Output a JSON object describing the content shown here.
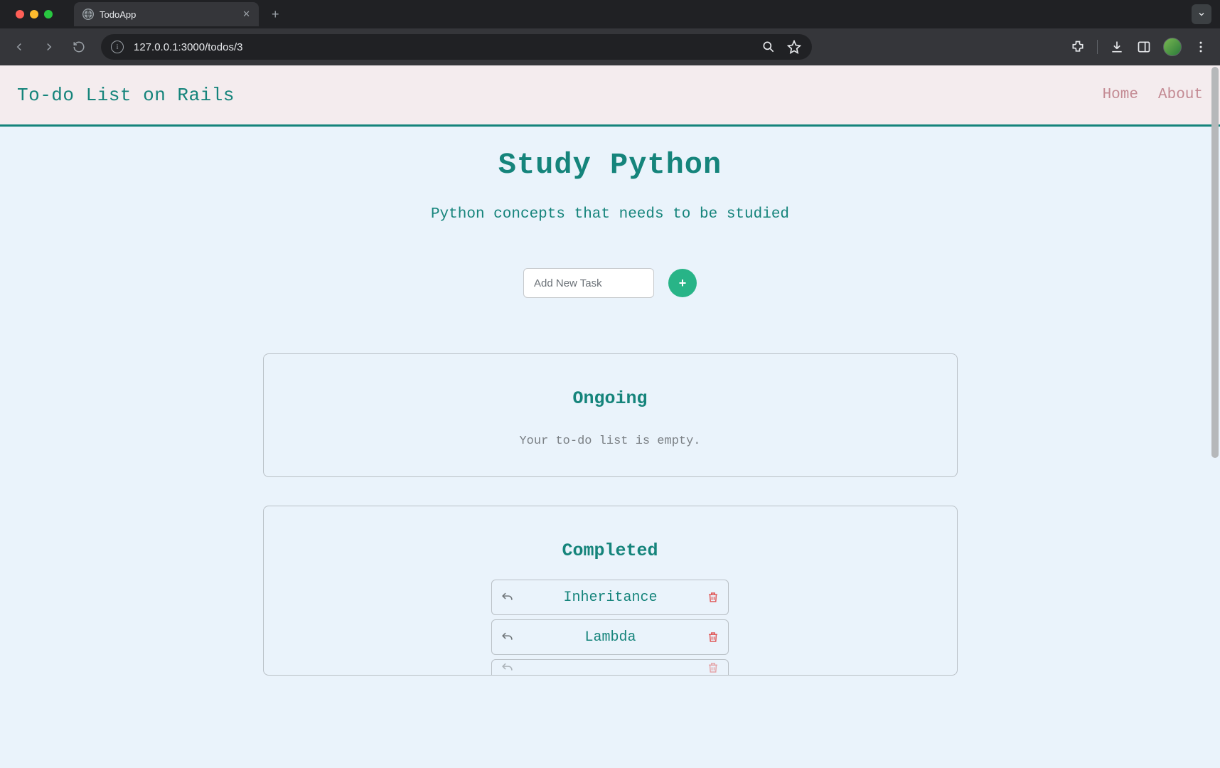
{
  "browser": {
    "tab_title": "TodoApp",
    "url_display": "127.0.0.1:3000/todos/3"
  },
  "header": {
    "brand": "To-do List on Rails",
    "nav": {
      "home": "Home",
      "about": "About"
    }
  },
  "page": {
    "title": "Study Python",
    "subtitle": "Python concepts that needs to be studied",
    "add_placeholder": "Add New Task"
  },
  "sections": {
    "ongoing": {
      "title": "Ongoing",
      "empty_text": "Your to-do list is empty."
    },
    "completed": {
      "title": "Completed",
      "tasks": [
        "Inheritance",
        "Lambda"
      ]
    }
  }
}
